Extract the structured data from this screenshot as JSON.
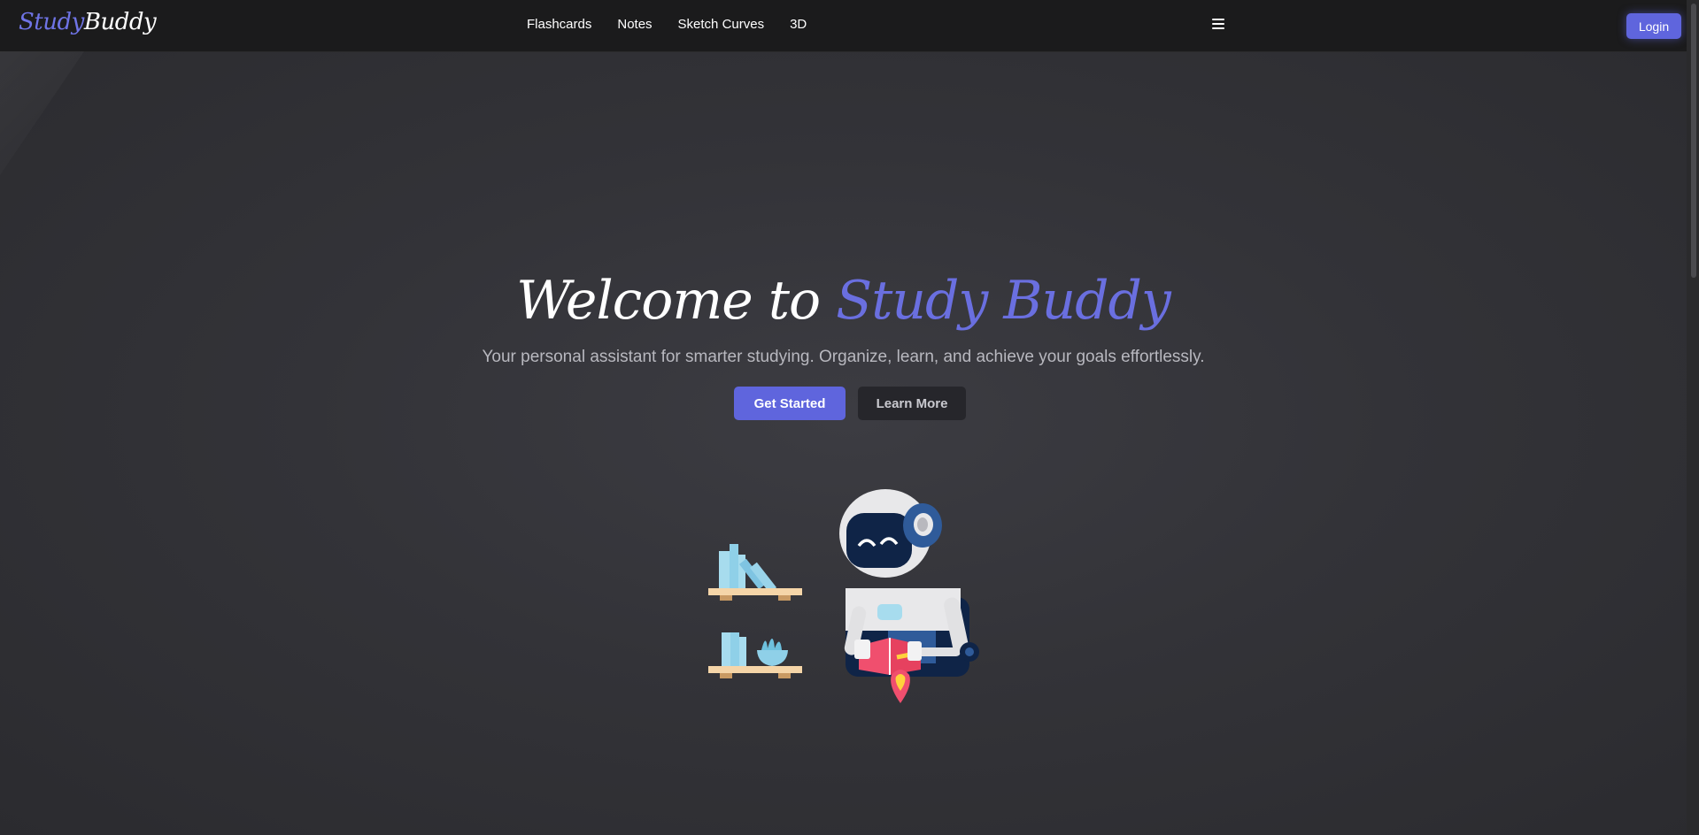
{
  "navbar": {
    "logo_part1": "Study",
    "logo_part2": "Buddy",
    "links": [
      "Flashcards",
      "Notes",
      "Sketch Curves",
      "3D"
    ],
    "menu_icon": "hamburger-menu-icon",
    "login_label": "Login"
  },
  "hero": {
    "title_prefix": "Welcome to ",
    "title_highlight": "Study Buddy",
    "subtitle": "Your personal assistant for smarter studying. Organize, learn, and achieve your goals effortlessly.",
    "primary_cta": "Get Started",
    "secondary_cta": "Learn More"
  },
  "colors": {
    "accent": "#5f65dd",
    "background": "#333338",
    "navbar": "#1b1b1c"
  }
}
